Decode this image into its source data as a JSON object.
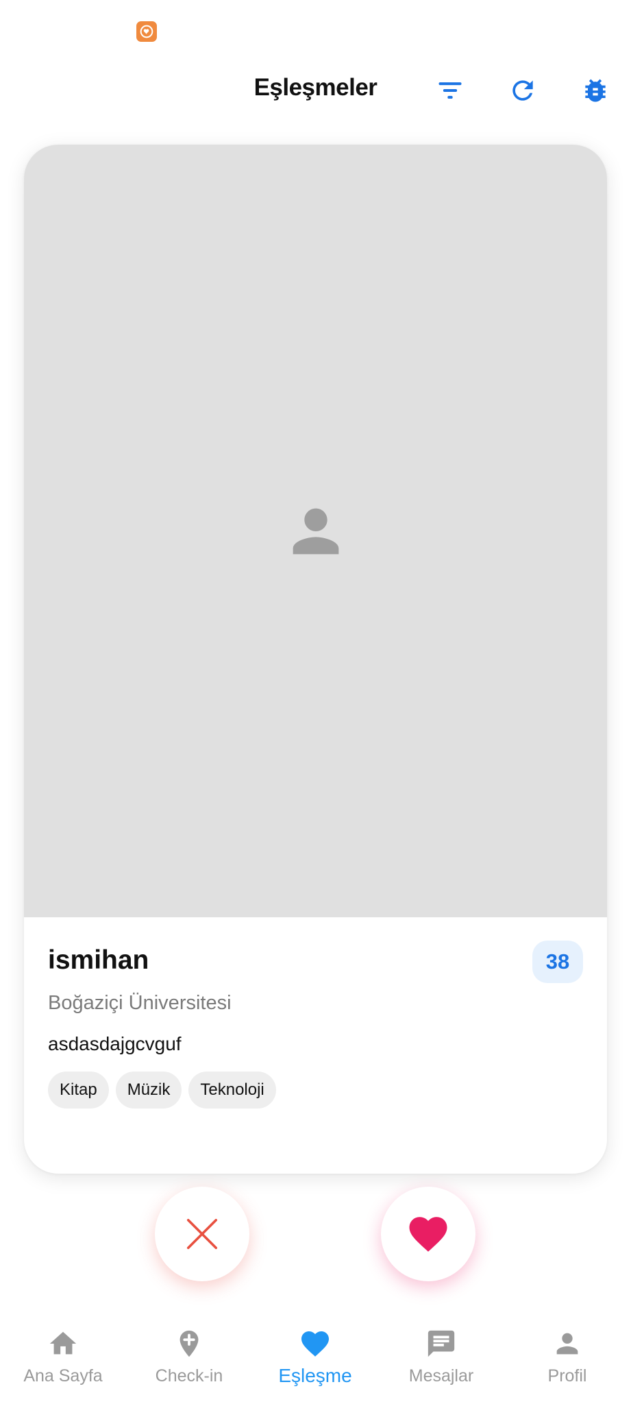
{
  "status_bar": {
    "app_icon": "heart-app-icon",
    "app_icon_color": "#f08a3e"
  },
  "header": {
    "title": "Eşleşmeler",
    "actions": [
      {
        "name": "filter-icon"
      },
      {
        "name": "refresh-icon"
      },
      {
        "name": "bug-icon"
      }
    ],
    "accent_color": "#1b74e4"
  },
  "profile": {
    "photo_placeholder": "person-icon",
    "name": "ismihan",
    "age": "38",
    "school": "Boğaziçi Üniversitesi",
    "bio": "asdasdajgcvguf",
    "interests": [
      "Kitap",
      "Müzik",
      "Teknoloji"
    ]
  },
  "actions": {
    "dislike": {
      "icon": "close-icon",
      "color": "#e8503f"
    },
    "like": {
      "icon": "heart-icon",
      "color": "#e91e63"
    }
  },
  "bottom_nav": {
    "items": [
      {
        "label": "Ana Sayfa",
        "icon": "home-icon",
        "active": false
      },
      {
        "label": "Check-in",
        "icon": "add-location-icon",
        "active": false
      },
      {
        "label": "Eşleşme",
        "icon": "heart-icon",
        "active": true
      },
      {
        "label": "Mesajlar",
        "icon": "chat-icon",
        "active": false
      },
      {
        "label": "Profil",
        "icon": "person-icon",
        "active": false
      }
    ],
    "active_color": "#2196f3",
    "inactive_color": "#9a9a9a"
  }
}
